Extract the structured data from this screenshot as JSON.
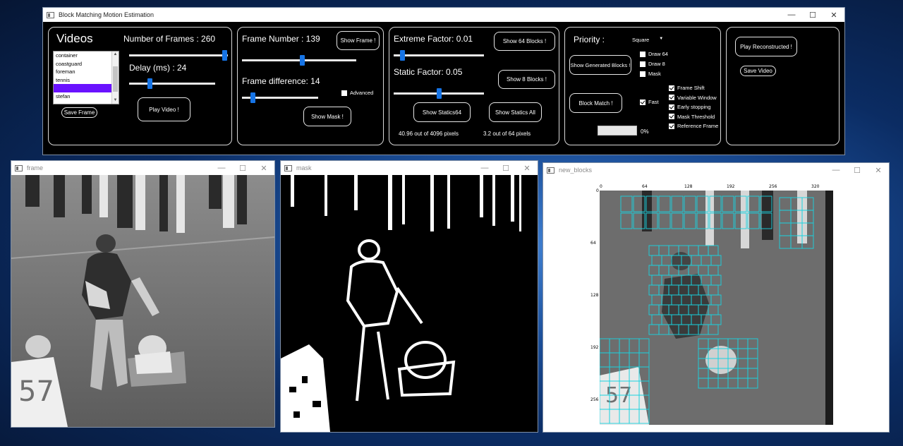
{
  "main_window": {
    "title": "Block Matching Motion Estimation",
    "controls": {
      "minimize": "—",
      "maximize": "☐",
      "close": "✕"
    }
  },
  "panel_videos": {
    "heading": "Videos",
    "videos": [
      "container",
      "coastguard",
      "foreman",
      "tennis",
      "football",
      "stefan",
      "..."
    ],
    "selected_index": 4,
    "frames_label": "Number of Frames : 260",
    "delay_label": "Delay (ms) : 24",
    "frames_slider_fraction": 0.97,
    "delay_slider_fraction": 0.24,
    "save_frame": "Save Frame",
    "play_video": "Play Video !"
  },
  "panel_frame": {
    "frame_number_label": "Frame Number : 139",
    "frame_number_slider_fraction": 0.53,
    "frame_difference_label": "Frame difference: 14",
    "frame_difference_slider_fraction": 0.14,
    "show_frame": "Show Frame !",
    "advanced": "Advanced",
    "show_mask": "Show Mask !"
  },
  "panel_statics": {
    "extreme_factor_label": "Extreme Factor: 0.01",
    "extreme_slider_fraction": 0.1,
    "static_factor_label": "Static  Factor: 0.05",
    "static_slider_fraction": 0.5,
    "show_64_blocks": "Show 64 Blocks !",
    "show_8_blocks": "Show 8 Blocks !",
    "show_statics64": "Show Statics64",
    "show_statics_all": "Show Statics All",
    "stat64": "40.96 out of 4096 pixels",
    "stat8": "3.2 out of 64 pixels"
  },
  "panel_match": {
    "priority_label": "Priority  :",
    "priority_value": "Square",
    "draw64": "Draw 64",
    "draw8": "Draw 8",
    "mask": "Mask",
    "show_generated": "Show Generated Blocks !",
    "block_match": "Block Match !",
    "fast": "Fast",
    "options": [
      "Frame Shift",
      "Variable Window",
      "Early stopping",
      "Mask Threshold",
      "Reference Frame"
    ],
    "progress_text": "0%",
    "progress_value": 0
  },
  "panel_reconstruct": {
    "play_reconstructed": "Play Reconstructed !",
    "save_video": "Save Video"
  },
  "frame_window": {
    "title": "frame"
  },
  "mask_window": {
    "title": "mask"
  },
  "blocks_window": {
    "title": "new_blocks",
    "x_ticks": [
      "0",
      "64",
      "128",
      "192",
      "256",
      "320"
    ],
    "y_ticks": [
      "0",
      "64",
      "128",
      "192",
      "256"
    ]
  },
  "colors": {
    "accent": "#1674e6",
    "selection": "#6a12ff",
    "block_outline": "#19d3e0"
  }
}
